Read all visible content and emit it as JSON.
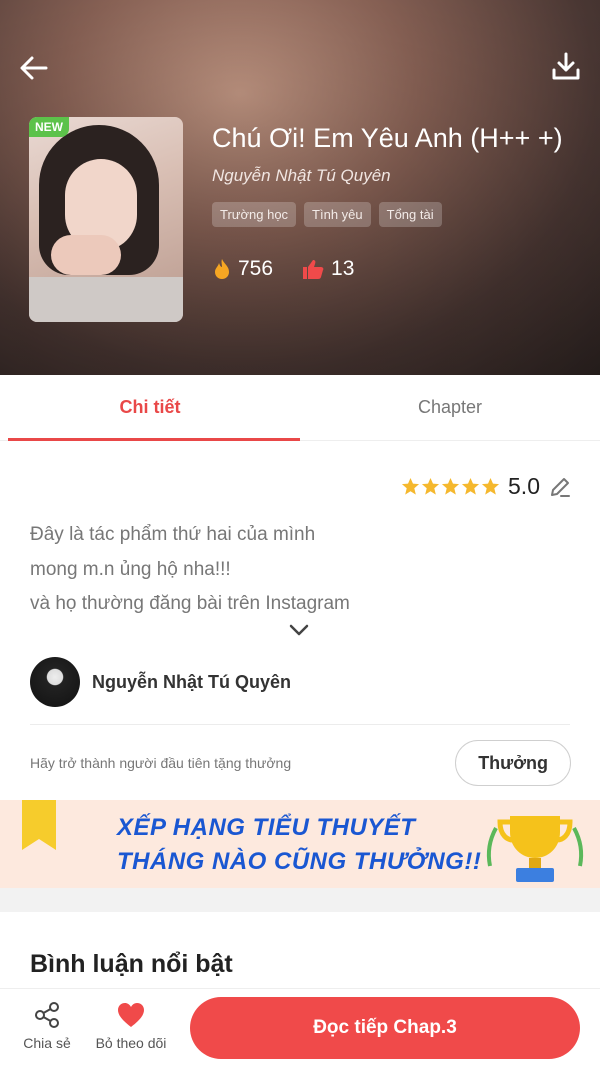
{
  "header": {
    "new_badge": "NEW",
    "title": "Chú Ơi! Em Yêu Anh (H++ +)",
    "author": "Nguyễn Nhật Tú Quyên",
    "tags": [
      "Trường học",
      "Tình yêu",
      "Tổng tài"
    ],
    "views": "756",
    "likes": "13"
  },
  "tabs": [
    {
      "label": "Chi tiết",
      "active": true
    },
    {
      "label": "Chapter",
      "active": false
    }
  ],
  "detail": {
    "rating": "5.0",
    "description": [
      "Đây là tác phẩm thứ hai của mình",
      "mong m.n ủng hộ nha!!!",
      "và họ thường đăng bài trên Instagram"
    ],
    "author_name": "Nguyễn Nhật Tú Quyên",
    "reward_prompt": "Hãy trở thành người đầu tiên tặng thưởng",
    "reward_button": "Thưởng"
  },
  "banner": {
    "line1": "XẾP HẠNG TIỂU THUYẾT",
    "line2": "THÁNG NÀO CŨNG THƯỞNG!!"
  },
  "comments": {
    "title": "Bình luận nổi bật"
  },
  "bottom_bar": {
    "share_label": "Chia sẻ",
    "unfollow_label": "Bỏ theo dõi",
    "read_button": "Đọc tiếp Chap.3"
  },
  "colors": {
    "accent": "#f04a4a",
    "tab_active": "#e94848",
    "badge_new": "#5cc24a",
    "star": "#f5b82e",
    "banner_text": "#1a57d2"
  },
  "icons": {
    "back": "arrow-left-icon",
    "download": "download-icon",
    "views": "fire-icon",
    "likes": "thumbs-up-icon",
    "edit": "pencil-icon",
    "expand": "chevron-down-icon",
    "share": "share-icon",
    "follow": "heart-icon"
  }
}
